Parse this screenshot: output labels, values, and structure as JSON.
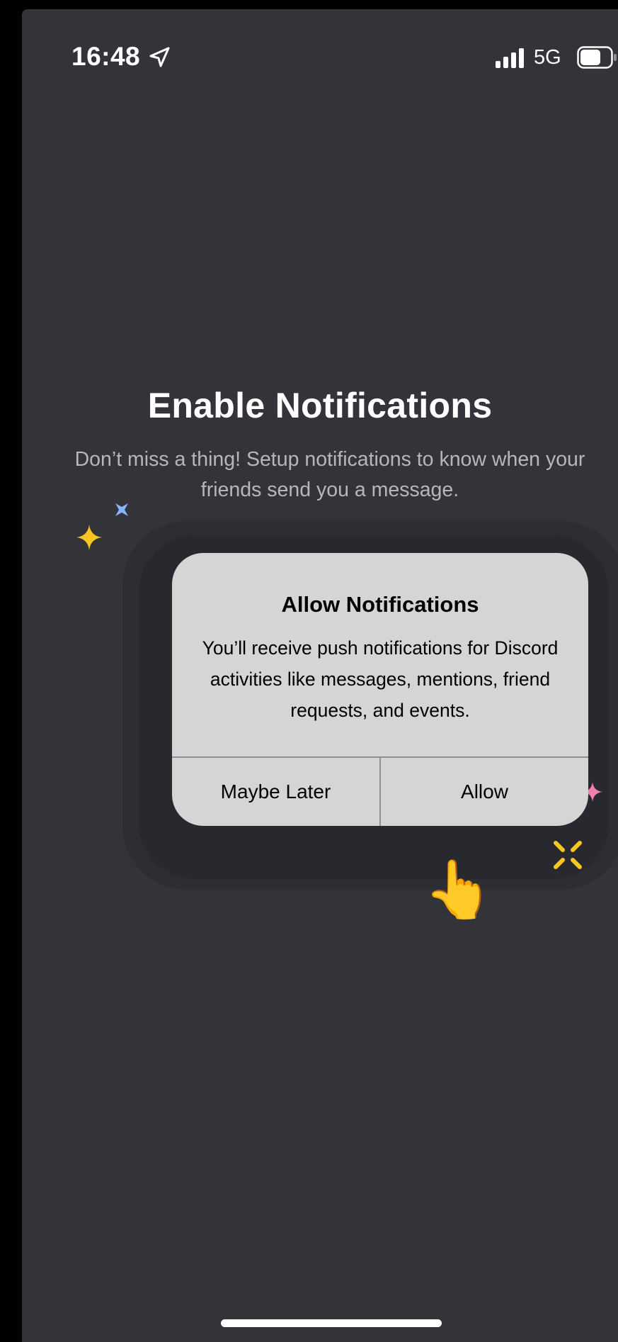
{
  "status_bar": {
    "time": "16:48",
    "network": "5G",
    "icons": [
      "location-arrow-icon",
      "signal-bars-icon",
      "battery-icon"
    ]
  },
  "page": {
    "title": "Enable Notifications",
    "subtitle": "Don’t miss a thing! Setup notifications to know when your friends send you a message."
  },
  "alert": {
    "title": "Allow Notifications",
    "message": "You’ll receive push notifications for Discord activities like messages, mentions, friend requests, and events.",
    "buttons": {
      "secondary": "Maybe Later",
      "primary": "Allow"
    }
  },
  "decorations": {
    "hand": "👆",
    "sparkle_colors": {
      "yellow": "#f7c623",
      "blue": "#8ab4f8",
      "pink": "#f47fae"
    }
  },
  "colors": {
    "background": "#323439",
    "alert_background": "#d5d5d5",
    "subtitle_text": "#b5b7bb"
  }
}
